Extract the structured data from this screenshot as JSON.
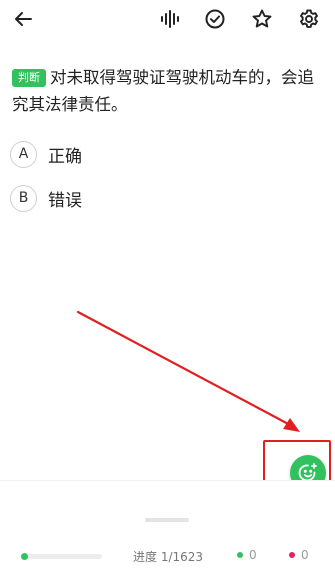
{
  "question": {
    "type_tag": "判断",
    "text": "对未取得驾驶证驾驶机动车的，会追究其法律责任。"
  },
  "options": [
    {
      "letter": "A",
      "text": "正确"
    },
    {
      "letter": "B",
      "text": "错误"
    }
  ],
  "progress": {
    "label": "进度 1/1623",
    "current": 1,
    "total": 1623
  },
  "stats": {
    "correct_count": "0",
    "wrong_count": "0"
  },
  "colors": {
    "accent_green": "#31c25f",
    "annotation_red": "#e02020",
    "wrong_red": "#e0245e"
  },
  "icons": {
    "back": "arrow-left-icon",
    "voice": "voice-wave-icon",
    "check": "check-circle-icon",
    "star": "star-icon",
    "settings": "gear-icon",
    "fab": "smile-sparkle-icon"
  }
}
